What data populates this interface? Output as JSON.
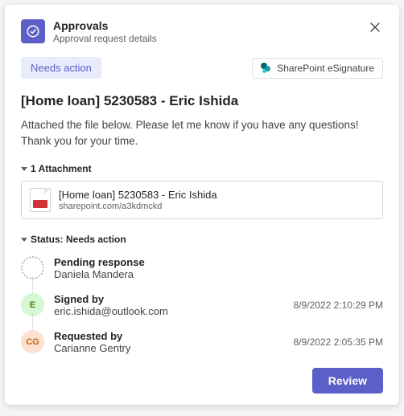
{
  "header": {
    "title": "Approvals",
    "subtitle": "Approval request details"
  },
  "badges": {
    "needs_action": "Needs action",
    "sharepoint": "SharePoint eSignature"
  },
  "request": {
    "title": "[Home loan] 5230583 - Eric Ishida",
    "body": "Attached the file below. Please let me know if you have any questions! Thank you for your time."
  },
  "attachments": {
    "label": "1 Attachment",
    "items": [
      {
        "name": "[Home loan] 5230583 - Eric Ishida",
        "link": "sharepoint.com/a3kdmckd"
      }
    ]
  },
  "status": {
    "label": "Status: Needs action",
    "items": [
      {
        "label": "Pending response",
        "sub": "Daniela Mandera",
        "time": "",
        "initials": "",
        "avatar": "pending"
      },
      {
        "label": "Signed by",
        "sub": "eric.ishida@outlook.com",
        "time": "8/9/2022 2:10:29 PM",
        "initials": "E",
        "avatar": "e"
      },
      {
        "label": "Requested by",
        "sub": "Carianne Gentry",
        "time": "8/9/2022 2:05:35 PM",
        "initials": "CG",
        "avatar": "cg"
      }
    ]
  },
  "footer": {
    "review": "Review"
  }
}
